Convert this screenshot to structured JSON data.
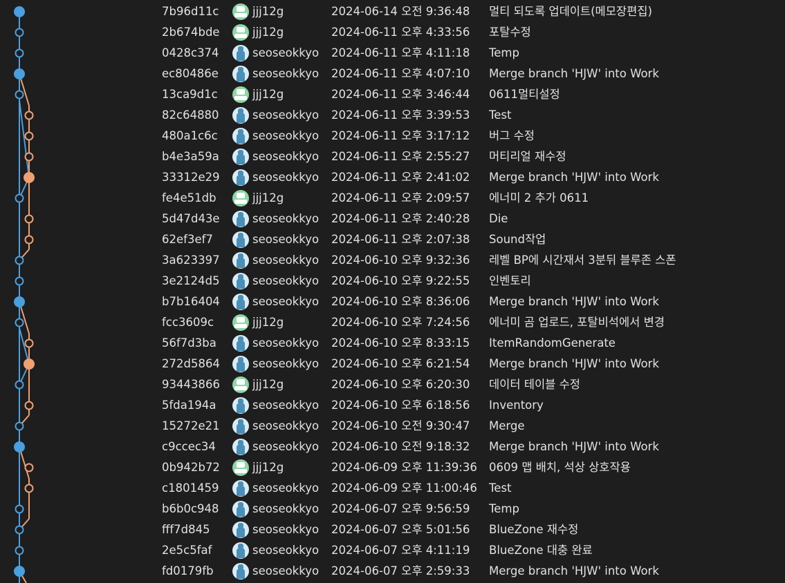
{
  "colors": {
    "background": "#1e1e1e",
    "text": "#e2e2e2",
    "lane_main": "#4a9fe0",
    "lane_branch": "#f0a070"
  },
  "avatars": {
    "jjj12g": "avatar-icon-green",
    "seoseokkyo": "avatar-icon-blue-person"
  },
  "commits": [
    {
      "hash": "7b96d11c",
      "author": "jjj12g",
      "date": "2024-06-14 오전 9:36:48",
      "message": "멀티 되도록 업데이트(메모장편집)"
    },
    {
      "hash": "2b674bde",
      "author": "jjj12g",
      "date": "2024-06-11 오후 4:33:56",
      "message": "포탈수정"
    },
    {
      "hash": "0428c374",
      "author": "seoseokkyo",
      "date": "2024-06-11 오후 4:11:18",
      "message": "Temp"
    },
    {
      "hash": "ec80486e",
      "author": "seoseokkyo",
      "date": "2024-06-11 오후 4:07:10",
      "message": "Merge branch 'HJW' into Work"
    },
    {
      "hash": "13ca9d1c",
      "author": "jjj12g",
      "date": "2024-06-11 오후 3:46:44",
      "message": "0611멀티설정"
    },
    {
      "hash": "82c64880",
      "author": "seoseokkyo",
      "date": "2024-06-11 오후 3:39:53",
      "message": "Test"
    },
    {
      "hash": "480a1c6c",
      "author": "seoseokkyo",
      "date": "2024-06-11 오후 3:17:12",
      "message": "버그 수정"
    },
    {
      "hash": "b4e3a59a",
      "author": "seoseokkyo",
      "date": "2024-06-11 오후 2:55:27",
      "message": "머티리얼 재수정"
    },
    {
      "hash": "33312e29",
      "author": "seoseokkyo",
      "date": "2024-06-11 오후 2:41:02",
      "message": "Merge branch 'HJW' into Work"
    },
    {
      "hash": "fe4e51db",
      "author": "jjj12g",
      "date": "2024-06-11 오후 2:09:57",
      "message": "에너미 2 추가 0611"
    },
    {
      "hash": "5d47d43e",
      "author": "seoseokkyo",
      "date": "2024-06-11 오후 2:40:28",
      "message": "Die"
    },
    {
      "hash": "62ef3ef7",
      "author": "seoseokkyo",
      "date": "2024-06-11 오후 2:07:38",
      "message": "Sound작업"
    },
    {
      "hash": "3a623397",
      "author": "seoseokkyo",
      "date": "2024-06-10 오후 9:32:36",
      "message": "레벨 BP에 시간재서 3분뒤 블루존 스폰"
    },
    {
      "hash": "3e2124d5",
      "author": "seoseokkyo",
      "date": "2024-06-10 오후 9:22:55",
      "message": "인벤토리"
    },
    {
      "hash": "b7b16404",
      "author": "seoseokkyo",
      "date": "2024-06-10 오후 8:36:06",
      "message": "Merge branch 'HJW' into Work"
    },
    {
      "hash": "fcc3609c",
      "author": "jjj12g",
      "date": "2024-06-10 오후 7:24:56",
      "message": "에너미 곰 업로드, 포탈비석에서 변경"
    },
    {
      "hash": "56f7d3ba",
      "author": "seoseokkyo",
      "date": "2024-06-10 오후 8:33:15",
      "message": "ItemRandomGenerate"
    },
    {
      "hash": "272d5864",
      "author": "seoseokkyo",
      "date": "2024-06-10 오후 6:21:54",
      "message": "Merge branch 'HJW' into Work"
    },
    {
      "hash": "93443866",
      "author": "jjj12g",
      "date": "2024-06-10 오후 6:20:30",
      "message": "데이터 테이블 수정"
    },
    {
      "hash": "5fda194a",
      "author": "seoseokkyo",
      "date": "2024-06-10 오후 6:18:56",
      "message": "Inventory"
    },
    {
      "hash": "15272e21",
      "author": "seoseokkyo",
      "date": "2024-06-10 오전 9:30:47",
      "message": "Merge"
    },
    {
      "hash": "c9ccec34",
      "author": "seoseokkyo",
      "date": "2024-06-10 오전 9:18:32",
      "message": "Merge branch 'HJW' into Work"
    },
    {
      "hash": "0b942b72",
      "author": "jjj12g",
      "date": "2024-06-09 오후 11:39:36",
      "message": "0609 맵 배치, 석상 상호작용"
    },
    {
      "hash": "c1801459",
      "author": "seoseokkyo",
      "date": "2024-06-09 오후 11:00:46",
      "message": "Test"
    },
    {
      "hash": "b6b0c948",
      "author": "seoseokkyo",
      "date": "2024-06-07 오후 9:56:59",
      "message": "Temp"
    },
    {
      "hash": "fff7d845",
      "author": "seoseokkyo",
      "date": "2024-06-07 오후 5:01:56",
      "message": "BlueZone 재수정"
    },
    {
      "hash": "2e5c5faf",
      "author": "seoseokkyo",
      "date": "2024-06-07 오후 4:11:19",
      "message": "BlueZone 대충 완료"
    },
    {
      "hash": "fd0179fb",
      "author": "seoseokkyo",
      "date": "2024-06-07 오후 2:59:33",
      "message": "Merge branch 'HJW' into Work"
    }
  ]
}
